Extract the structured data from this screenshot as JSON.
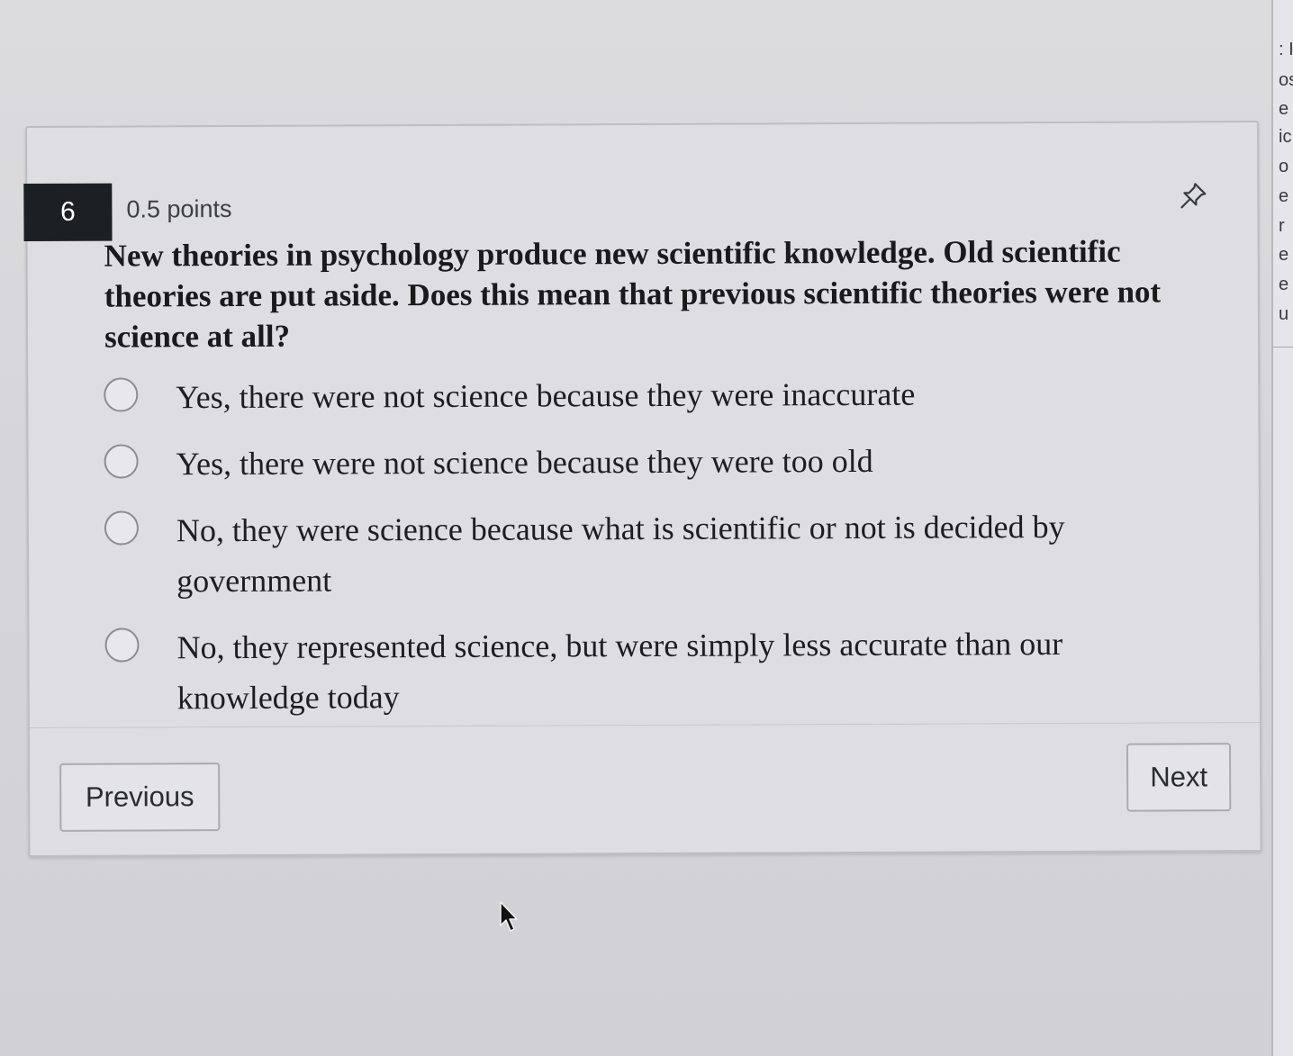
{
  "question": {
    "number": "6",
    "points": "0.5 points",
    "text": "New theories in psychology produce new scientific knowledge. Old scientific theories are put aside. Does this mean that previous scientific theories were not science at all?",
    "options": [
      {
        "label": "Yes, there were not science because they were inaccurate"
      },
      {
        "label": "Yes, there were not science because they were too old"
      },
      {
        "label": "No, they were science because what is scientific or not is decided by government"
      },
      {
        "label": "No, they represented science, but were simply less accurate than our knowledge today"
      }
    ]
  },
  "nav": {
    "previous_label": "Previous",
    "next_label": "Next"
  },
  "side_panel": {
    "fragments": [
      ": I",
      "os",
      "e",
      "ic",
      "o",
      "e",
      "r",
      "e",
      "e",
      "u"
    ]
  },
  "icons": {
    "pin": "pin-icon",
    "cursor": "mouse-pointer-icon"
  },
  "colors": {
    "question_badge_bg": "#1c1f24",
    "page_bg": "#d6d6da",
    "card_bg": "#dedee2"
  }
}
